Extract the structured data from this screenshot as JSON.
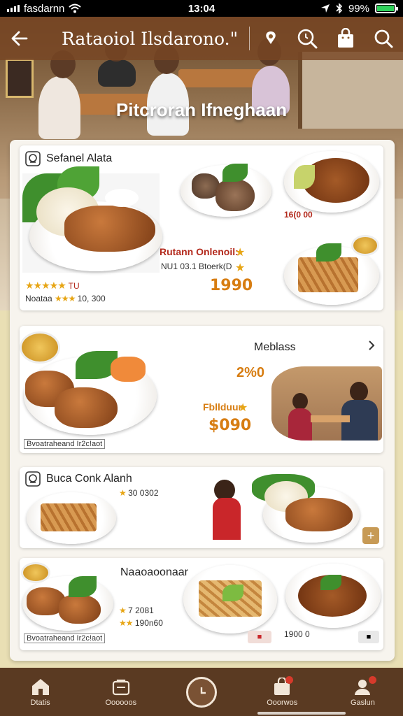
{
  "status_bar": {
    "carrier": "fasdarnn",
    "time": "13:04",
    "battery_text": "99%",
    "battery_level": 0.99
  },
  "header": {
    "title": "Rataoiol Ilsdarono.\"",
    "subtitle": "Pitcroran Ifneghaan"
  },
  "cards": [
    {
      "title": "Sefanel Alata",
      "name_line": "Rutann Onlenoil:",
      "detail_line": "NU1 03.1 Btoerk(D",
      "rating_text": "TU",
      "review_label": "Noataa",
      "review_count": "10, 300",
      "side_price": "16(0 00",
      "price": "1990"
    },
    {
      "title": "Meblass",
      "percent": "2%0",
      "name_line": "Fbllduur",
      "price": "$090",
      "footer": "Bvoatraheand  Ir2c!aot"
    },
    {
      "title": "Buca Conk Alanh",
      "rating_text": "30 0302"
    },
    {
      "title": "Naaoaoonaar",
      "rating_line_1": "7 2081",
      "rating_line_2": "190n60",
      "price": "1900 0",
      "footer": "Bvoatraheand  Ir2c!aot"
    }
  ],
  "nav": {
    "items": [
      "Dtatis",
      "Oooooos",
      "",
      "Ooorwos",
      "Gaslun"
    ]
  },
  "colors": {
    "brand_brown": "#5a3a22",
    "accent_orange": "#d77d12",
    "star_gold": "#e7a514"
  }
}
